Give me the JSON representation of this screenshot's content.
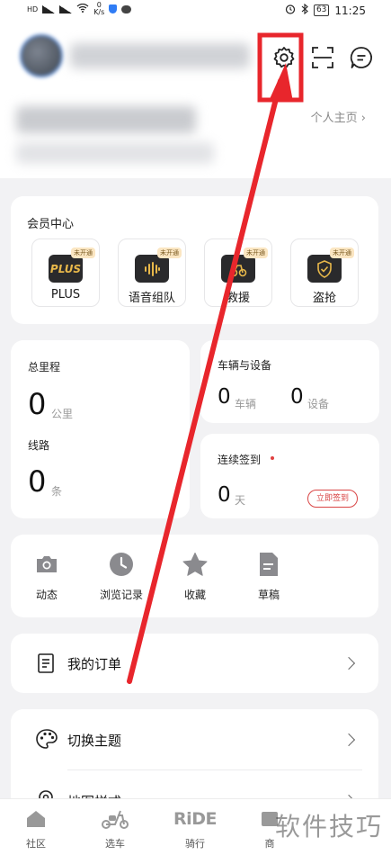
{
  "status_bar": {
    "network_left": "HD",
    "net_speed": "0",
    "net_speed_unit": "K/s",
    "battery": "63",
    "time": "11:25"
  },
  "header": {
    "homepage_link": "个人主页 ›"
  },
  "member_center": {
    "title": "会员中心",
    "items": [
      {
        "label": "PLUS",
        "badge": "未开通",
        "icon": "plus-icon",
        "icon_text": "PLUS"
      },
      {
        "label": "语音组队",
        "badge": "未开通",
        "icon": "voice-team-icon"
      },
      {
        "label": "救援",
        "badge": "未开通",
        "icon": "rescue-icon"
      },
      {
        "label": "盗抢",
        "badge": "未开通",
        "icon": "anti-theft-icon"
      }
    ]
  },
  "mileage": {
    "total_label": "总里程",
    "total_value": "0",
    "total_unit": "公里",
    "routes_label": "线路",
    "routes_value": "0",
    "routes_unit": "条"
  },
  "vehicles": {
    "title": "车辆与设备",
    "vehicle_count": "0",
    "vehicle_unit": "车辆",
    "device_count": "0",
    "device_unit": "设备"
  },
  "checkin": {
    "title": "连续签到",
    "days": "0",
    "days_unit": "天",
    "button": "立即签到"
  },
  "quick_links": [
    {
      "label": "动态",
      "icon": "camera-icon"
    },
    {
      "label": "浏览记录",
      "icon": "clock-icon"
    },
    {
      "label": "收藏",
      "icon": "star-icon"
    },
    {
      "label": "草稿",
      "icon": "draft-icon"
    }
  ],
  "orders": {
    "label": "我的订单"
  },
  "menu": {
    "theme_label": "切换主题",
    "map_label": "地图样式"
  },
  "tabs": [
    {
      "label": "社区",
      "icon": "home-icon"
    },
    {
      "label": "选车",
      "icon": "scooter-icon"
    },
    {
      "label": "骑行",
      "icon": "ride-icon",
      "logo_text": "RiDE"
    },
    {
      "label": "商",
      "icon": "shop-icon"
    }
  ],
  "watermark": "软件技巧",
  "colors": {
    "accent_red": "#e8262c",
    "background": "#f2f2f4",
    "card": "#ffffff"
  }
}
